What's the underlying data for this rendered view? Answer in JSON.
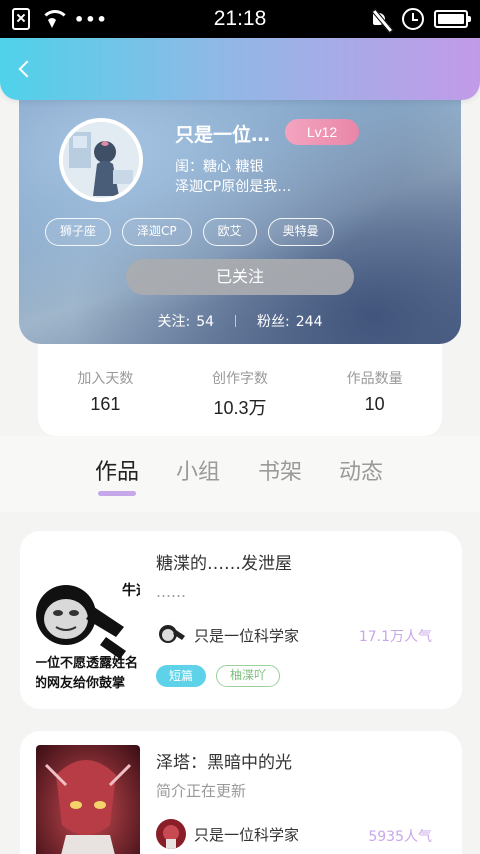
{
  "status_bar": {
    "time": "21:18",
    "dots": "•••"
  },
  "profile": {
    "name": "只是一位…",
    "level": "Lv12",
    "bio_line1": "闺：糖心 糖银",
    "bio_line2": "泽迦CP原创是我…",
    "tags": [
      "狮子座",
      "泽迦CP",
      "欧艾",
      "奥特曼"
    ],
    "follow_button": "已关注",
    "following_label": "关注:",
    "following_count": "54",
    "fans_label": "粉丝:",
    "fans_count": "244"
  },
  "info": [
    {
      "label": "加入天数",
      "value": "161"
    },
    {
      "label": "创作字数",
      "value": "10.3万"
    },
    {
      "label": "作品数量",
      "value": "10"
    }
  ],
  "tabs": [
    "作品",
    "小组",
    "书架",
    "动态"
  ],
  "works": [
    {
      "title": "糖渫的……发泄屋",
      "description": "……",
      "author": "只是一位科学家",
      "popularity": "17.1万人气",
      "category": "短篇",
      "tag": "柚渫吖",
      "cover_text_top": "牛逼",
      "cover_text_mid": "一位不愿透露姓名",
      "cover_text_bot": "的网友给你鼓掌"
    },
    {
      "title": "泽塔：黑暗中的光",
      "description": "简介正在更新",
      "author": "只是一位科学家",
      "popularity": "5935人气"
    }
  ],
  "colors": {
    "header_start": "#4fd2ea",
    "header_end": "#c29be8",
    "level_badge": "#e986a8",
    "tab_indicator": "#c6a7ea",
    "category_badge": "#5ed2e8",
    "popularity": "#c8a6ea"
  }
}
